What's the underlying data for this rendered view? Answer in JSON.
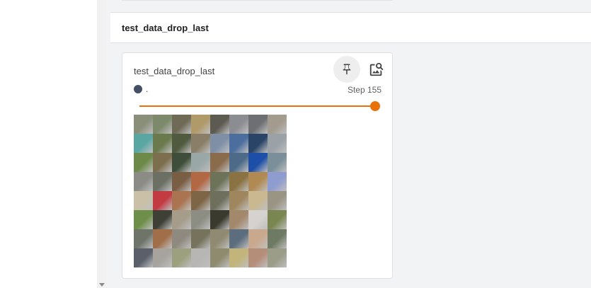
{
  "group": {
    "title": "test_data_drop_last"
  },
  "card": {
    "title": "test_data_drop_last",
    "run_label": ".",
    "step_label": "Step 155",
    "slider_fraction": 1.0,
    "pin_icon": "pin-icon",
    "image_icon": "image-search-icon",
    "run_color": "#425066",
    "accent_color": "#e8710a"
  },
  "image_grid": {
    "rows": 8,
    "cols": 8,
    "tile_colors": [
      "#8a8f7a",
      "#7c8a6b",
      "#6f6a55",
      "#b09a6a",
      "#5d5a52",
      "#8b8d92",
      "#6d6f73",
      "#a29b8e",
      "#5aa6a3",
      "#6b7a4d",
      "#4f5a3f",
      "#8a7e68",
      "#7e8fa6",
      "#4b6e9e",
      "#2a4468",
      "#9aa2a8",
      "#6e8a4a",
      "#7d6e4e",
      "#3f4e3a",
      "#9aa7a7",
      "#8a6b4b",
      "#4d6b88",
      "#1d4fa8",
      "#7a8f9a",
      "#8c8c86",
      "#6c6f64",
      "#7a5e44",
      "#b36844",
      "#6d7359",
      "#8a7242",
      "#b08a52",
      "#8e9ccf",
      "#c9c0a7",
      "#c23a42",
      "#a9744f",
      "#7d6546",
      "#6e6f5c",
      "#9f865f",
      "#c9b890",
      "#9a9484",
      "#6d8f49",
      "#3e3f35",
      "#a59c8a",
      "#8c8d83",
      "#3b3a2f",
      "#a3886c",
      "#d5d2cf",
      "#7a8652",
      "#6e7468",
      "#a06e48",
      "#8e8a7f",
      "#75735b",
      "#8f8a71",
      "#5c6e7d",
      "#c9a98e",
      "#6f7a65",
      "#5a5f6a",
      "#a7a4a0",
      "#9da07e",
      "#b7b6b4",
      "#8f8b6f",
      "#c2b47a",
      "#b58e7a",
      "#9b9d89"
    ]
  }
}
